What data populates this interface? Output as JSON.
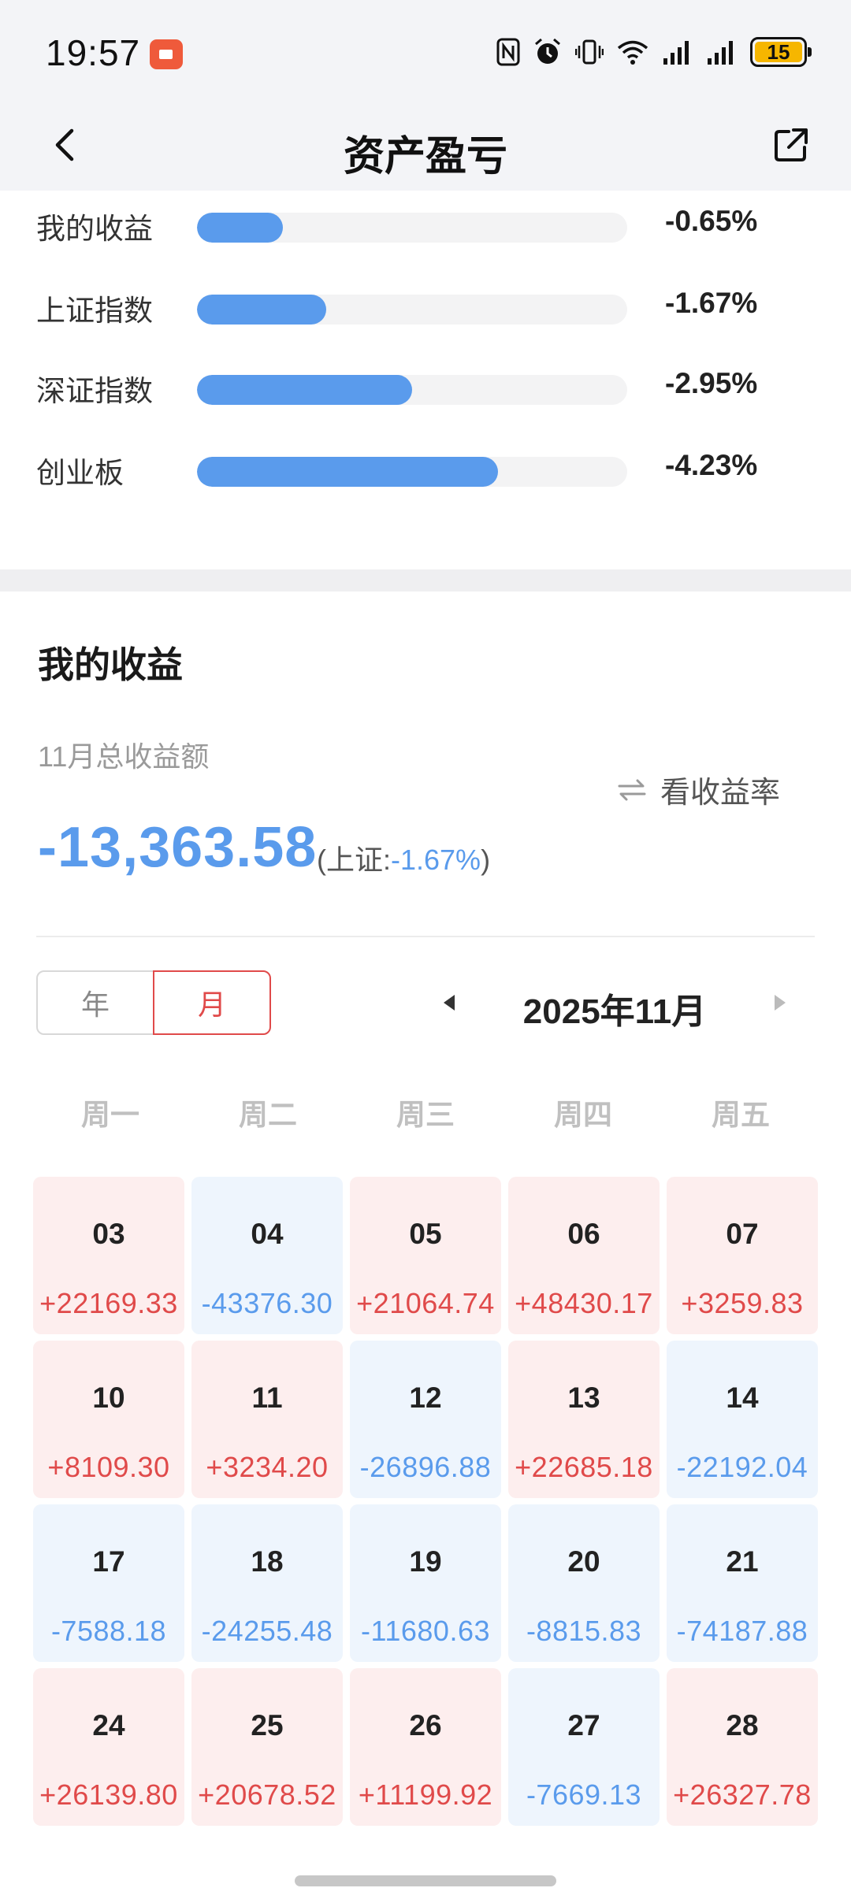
{
  "status_bar": {
    "time": "19:57",
    "battery": "15"
  },
  "nav": {
    "title": "资产盈亏"
  },
  "comparison": {
    "items": [
      {
        "label": "我的收益",
        "value": "-0.65%",
        "bar_fraction": 0.2
      },
      {
        "label": "上证指数",
        "value": "-1.67%",
        "bar_fraction": 0.3
      },
      {
        "label": "深证指数",
        "value": "-2.95%",
        "bar_fraction": 0.5
      },
      {
        "label": "创业板",
        "value": "-4.23%",
        "bar_fraction": 0.7
      }
    ],
    "bar_color": "#5a9bec"
  },
  "profit": {
    "title": "我的收益",
    "month_total_label": "11月总收益额",
    "toggle_label": "看收益率",
    "amount": "-13,363.58",
    "compare_prefix": "(上证:",
    "compare_value": "-1.67%",
    "compare_suffix": ")"
  },
  "period": {
    "year_label": "年",
    "month_label": "月",
    "selected": "月",
    "current": "2025年11月"
  },
  "calendar": {
    "weekdays": [
      "周一",
      "周二",
      "周三",
      "周四",
      "周五"
    ],
    "days": [
      {
        "day": "03",
        "value": "+22169.33",
        "sign": "pos"
      },
      {
        "day": "04",
        "value": "-43376.30",
        "sign": "neg"
      },
      {
        "day": "05",
        "value": "+21064.74",
        "sign": "pos"
      },
      {
        "day": "06",
        "value": "+48430.17",
        "sign": "pos"
      },
      {
        "day": "07",
        "value": "+3259.83",
        "sign": "pos"
      },
      {
        "day": "10",
        "value": "+8109.30",
        "sign": "pos"
      },
      {
        "day": "11",
        "value": "+3234.20",
        "sign": "pos"
      },
      {
        "day": "12",
        "value": "-26896.88",
        "sign": "neg"
      },
      {
        "day": "13",
        "value": "+22685.18",
        "sign": "pos"
      },
      {
        "day": "14",
        "value": "-22192.04",
        "sign": "neg"
      },
      {
        "day": "17",
        "value": "-7588.18",
        "sign": "neg"
      },
      {
        "day": "18",
        "value": "-24255.48",
        "sign": "neg"
      },
      {
        "day": "19",
        "value": "-11680.63",
        "sign": "neg"
      },
      {
        "day": "20",
        "value": "-8815.83",
        "sign": "neg"
      },
      {
        "day": "21",
        "value": "-74187.88",
        "sign": "neg"
      },
      {
        "day": "24",
        "value": "+26139.80",
        "sign": "pos"
      },
      {
        "day": "25",
        "value": "+20678.52",
        "sign": "pos"
      },
      {
        "day": "26",
        "value": "+11199.92",
        "sign": "pos"
      },
      {
        "day": "27",
        "value": "-7669.13",
        "sign": "neg"
      },
      {
        "day": "28",
        "value": "+26327.78",
        "sign": "pos"
      }
    ]
  },
  "colors": {
    "profit": "#e04a4a",
    "loss": "#5a9bec",
    "accent": "#e04a4a"
  }
}
